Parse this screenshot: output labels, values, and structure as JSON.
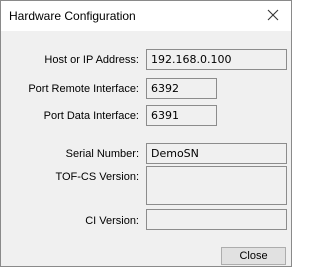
{
  "window": {
    "title": "Hardware Configuration"
  },
  "fields": {
    "host": {
      "label": "Host or IP Address:",
      "value": "192.168.0.100"
    },
    "port_remote": {
      "label": "Port Remote Interface:",
      "value": "6392"
    },
    "port_data": {
      "label": "Port Data Interface:",
      "value": "6391"
    },
    "serial": {
      "label": "Serial Number:",
      "value": "DemoSN"
    },
    "tof_cs": {
      "label": "TOF-CS Version:",
      "value": ""
    },
    "ci": {
      "label": "CI Version:",
      "value": ""
    }
  },
  "buttons": {
    "close_label": "Close"
  },
  "icons": {
    "close": "close-icon"
  }
}
